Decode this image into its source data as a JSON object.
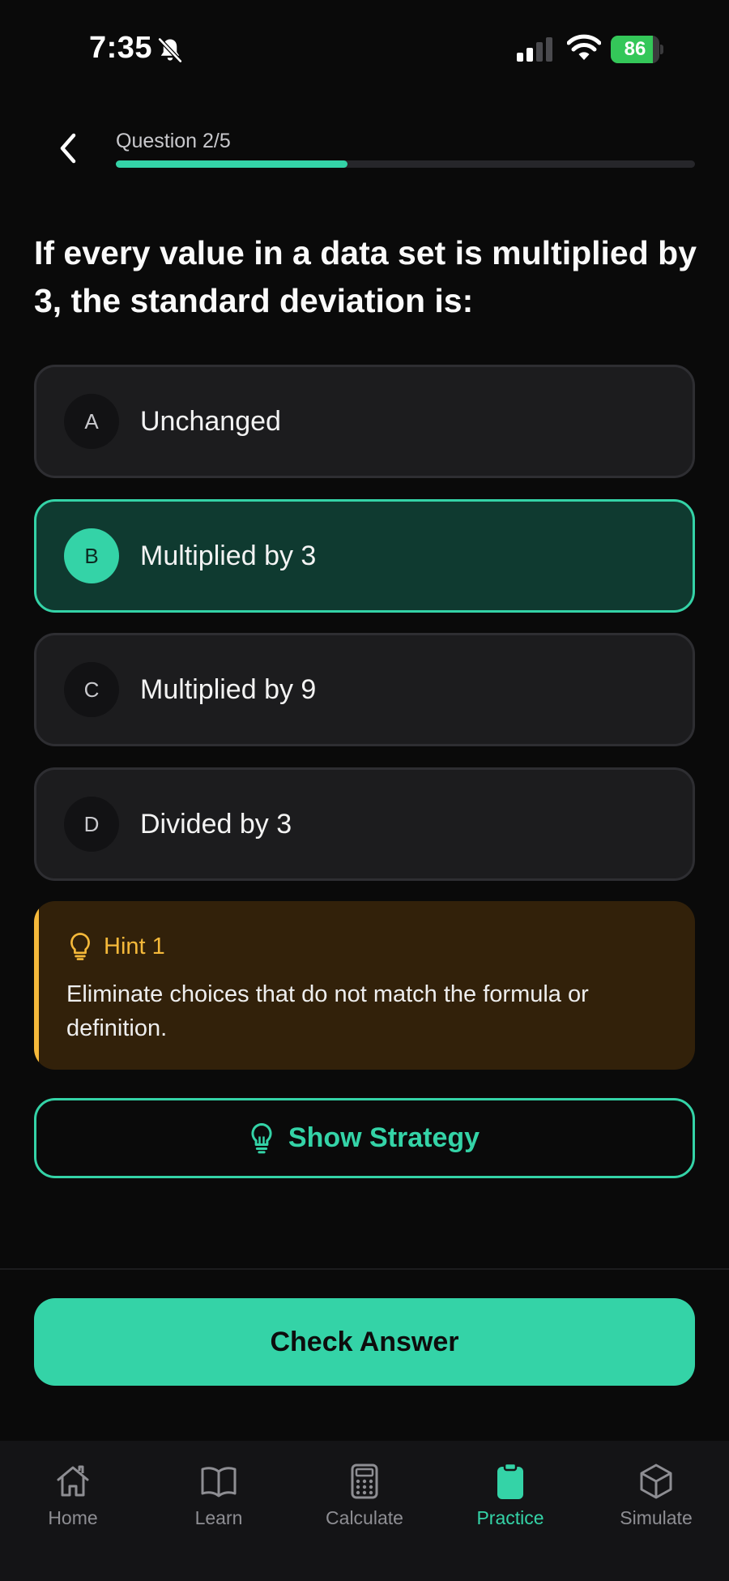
{
  "status_bar": {
    "time": "7:35",
    "battery": "86",
    "battery_level": 0.86
  },
  "header": {
    "question_label": "Question 2/5",
    "progress": 0.4
  },
  "question": {
    "text": "If every value in a data set is multiplied by 3, the standard deviation is:"
  },
  "options": [
    {
      "letter": "A",
      "text": "Unchanged",
      "selected": false
    },
    {
      "letter": "B",
      "text": "Multiplied by 3",
      "selected": true
    },
    {
      "letter": "C",
      "text": "Multiplied by 9",
      "selected": false
    },
    {
      "letter": "D",
      "text": "Divided by 3",
      "selected": false
    }
  ],
  "hint": {
    "title": "Hint 1",
    "body": "Eliminate choices that do not match the formula or definition.",
    "icon": "lightbulb-icon"
  },
  "strategy_button": {
    "label": "Show Strategy",
    "icon": "lightbulb-icon"
  },
  "check_button": {
    "label": "Check Answer"
  },
  "tabbar": {
    "active": "Practice",
    "items": [
      {
        "label": "Home",
        "icon": "home-icon"
      },
      {
        "label": "Learn",
        "icon": "book-icon"
      },
      {
        "label": "Calculate",
        "icon": "calculator-icon"
      },
      {
        "label": "Practice",
        "icon": "clipboard-icon"
      },
      {
        "label": "Simulate",
        "icon": "cube-icon"
      }
    ]
  },
  "colors": {
    "accent": "#34d3a7",
    "background": "#0a0a0a",
    "card": "#1c1c1e",
    "selected_card": "#0f3a30",
    "hint_background": "#32210a",
    "hint_accent": "#f5b93a",
    "inactive_tab": "#8e8e93"
  }
}
